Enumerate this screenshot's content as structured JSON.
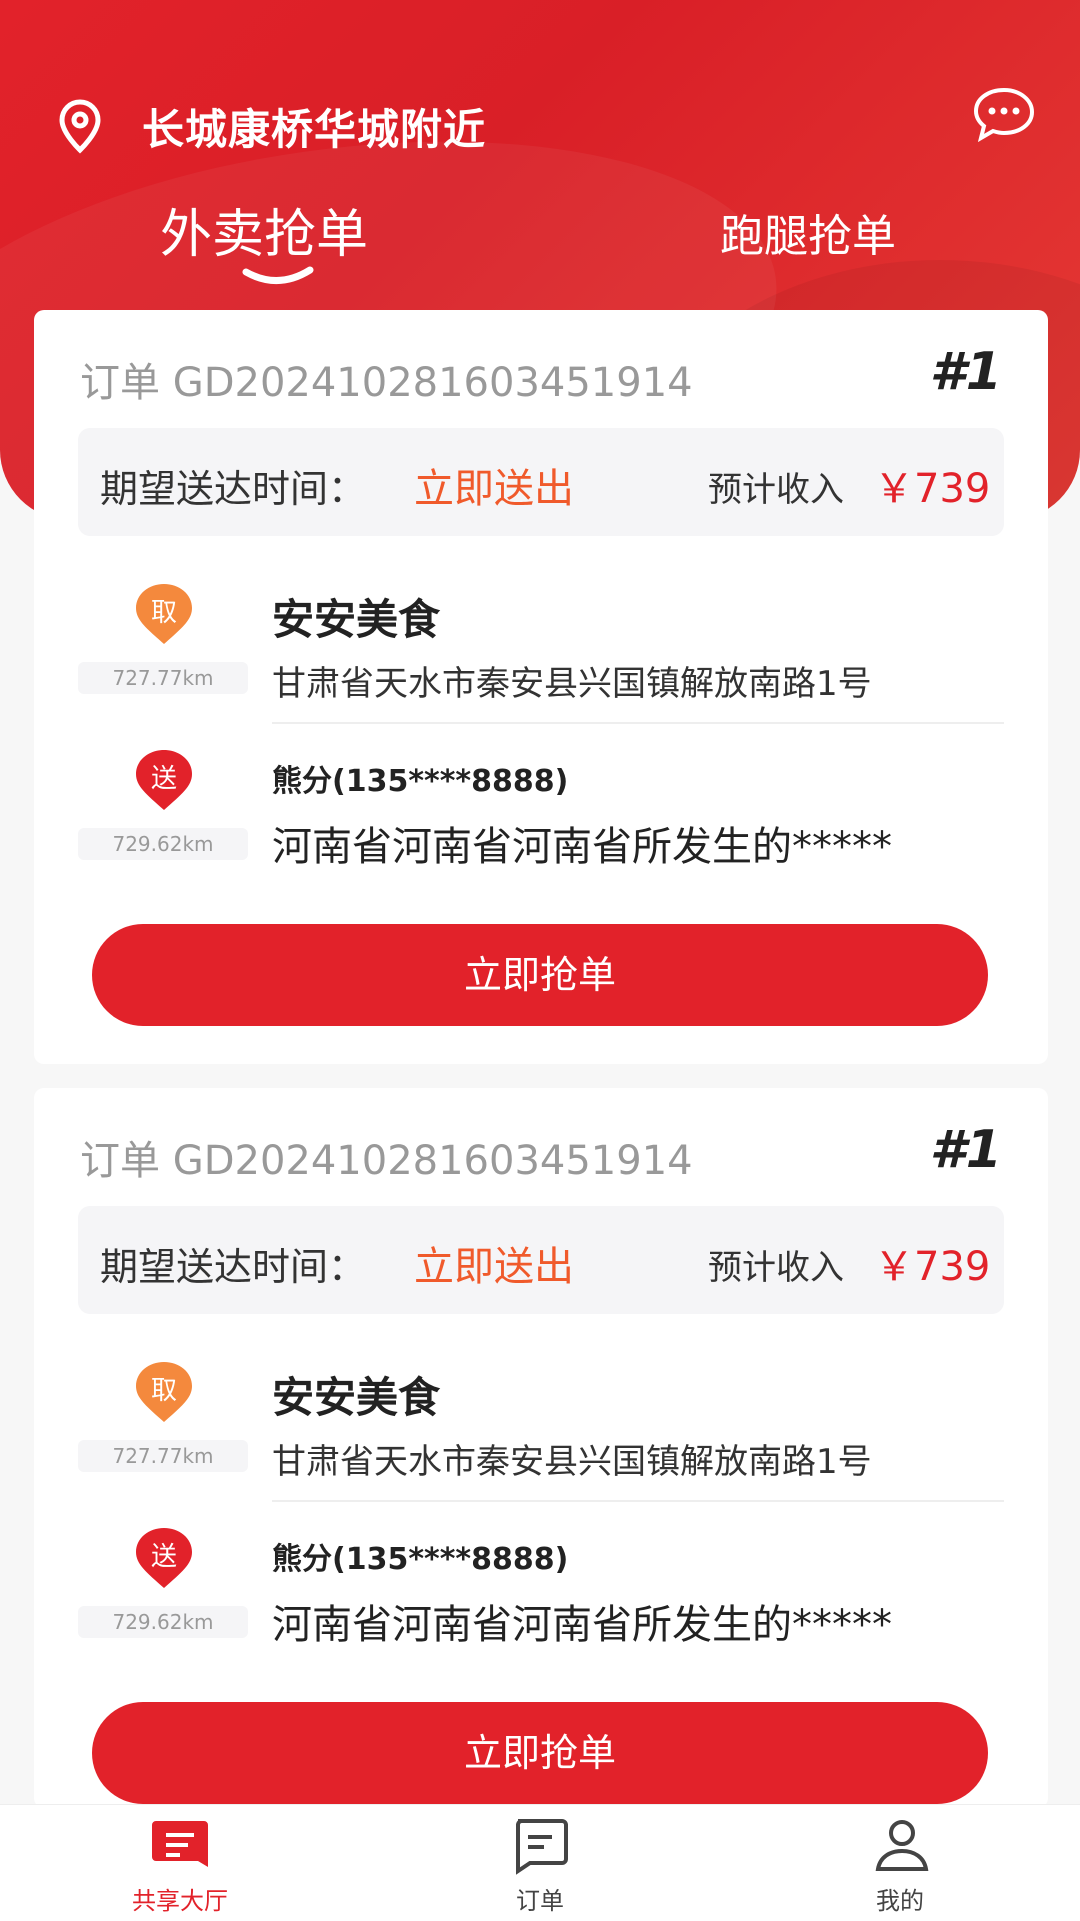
{
  "header": {
    "location": "长城康桥华城附近",
    "tabs": [
      {
        "label": "外卖抢单",
        "active": true
      },
      {
        "label": "跑腿抢单",
        "active": false
      }
    ]
  },
  "colors": {
    "brand_red": "#e2222a",
    "orange": "#f05a2b",
    "pickup_badge": "#f4893d"
  },
  "orders": [
    {
      "order_no": "订单 GD20241028160345​1914",
      "index": "#1",
      "time_label": "期望送达时间：",
      "time_value": "立即送出",
      "income_label": "预计收入",
      "income_value": "￥739",
      "pickup": {
        "badge": "取",
        "distance": "727.77km",
        "name": "安安美食",
        "address": "甘肃省天水市秦安县兴国镇解放南路1号"
      },
      "delivery": {
        "badge": "送",
        "distance": "729.62km",
        "receiver": "熊分(135****8888)",
        "address": "河南省河南省河南省所发生的*****"
      },
      "button": "立即抢单"
    },
    {
      "order_no": "订单 GD20241028160345​1914",
      "index": "#1",
      "time_label": "期望送达时间：",
      "time_value": "立即送出",
      "income_label": "预计收入",
      "income_value": "￥739",
      "pickup": {
        "badge": "取",
        "distance": "727.77km",
        "name": "安安美食",
        "address": "甘肃省天水市秦安县兴国镇解放南路1号"
      },
      "delivery": {
        "badge": "送",
        "distance": "729.62km",
        "receiver": "熊分(135****8888)",
        "address": "河南省河南省河南省所发生的*****"
      },
      "button": "立即抢单"
    }
  ],
  "bottom_nav": [
    {
      "label": "共享大厅",
      "active": true,
      "icon": "hall-icon"
    },
    {
      "label": "订单",
      "active": false,
      "icon": "order-icon"
    },
    {
      "label": "我的",
      "active": false,
      "icon": "user-icon"
    }
  ]
}
